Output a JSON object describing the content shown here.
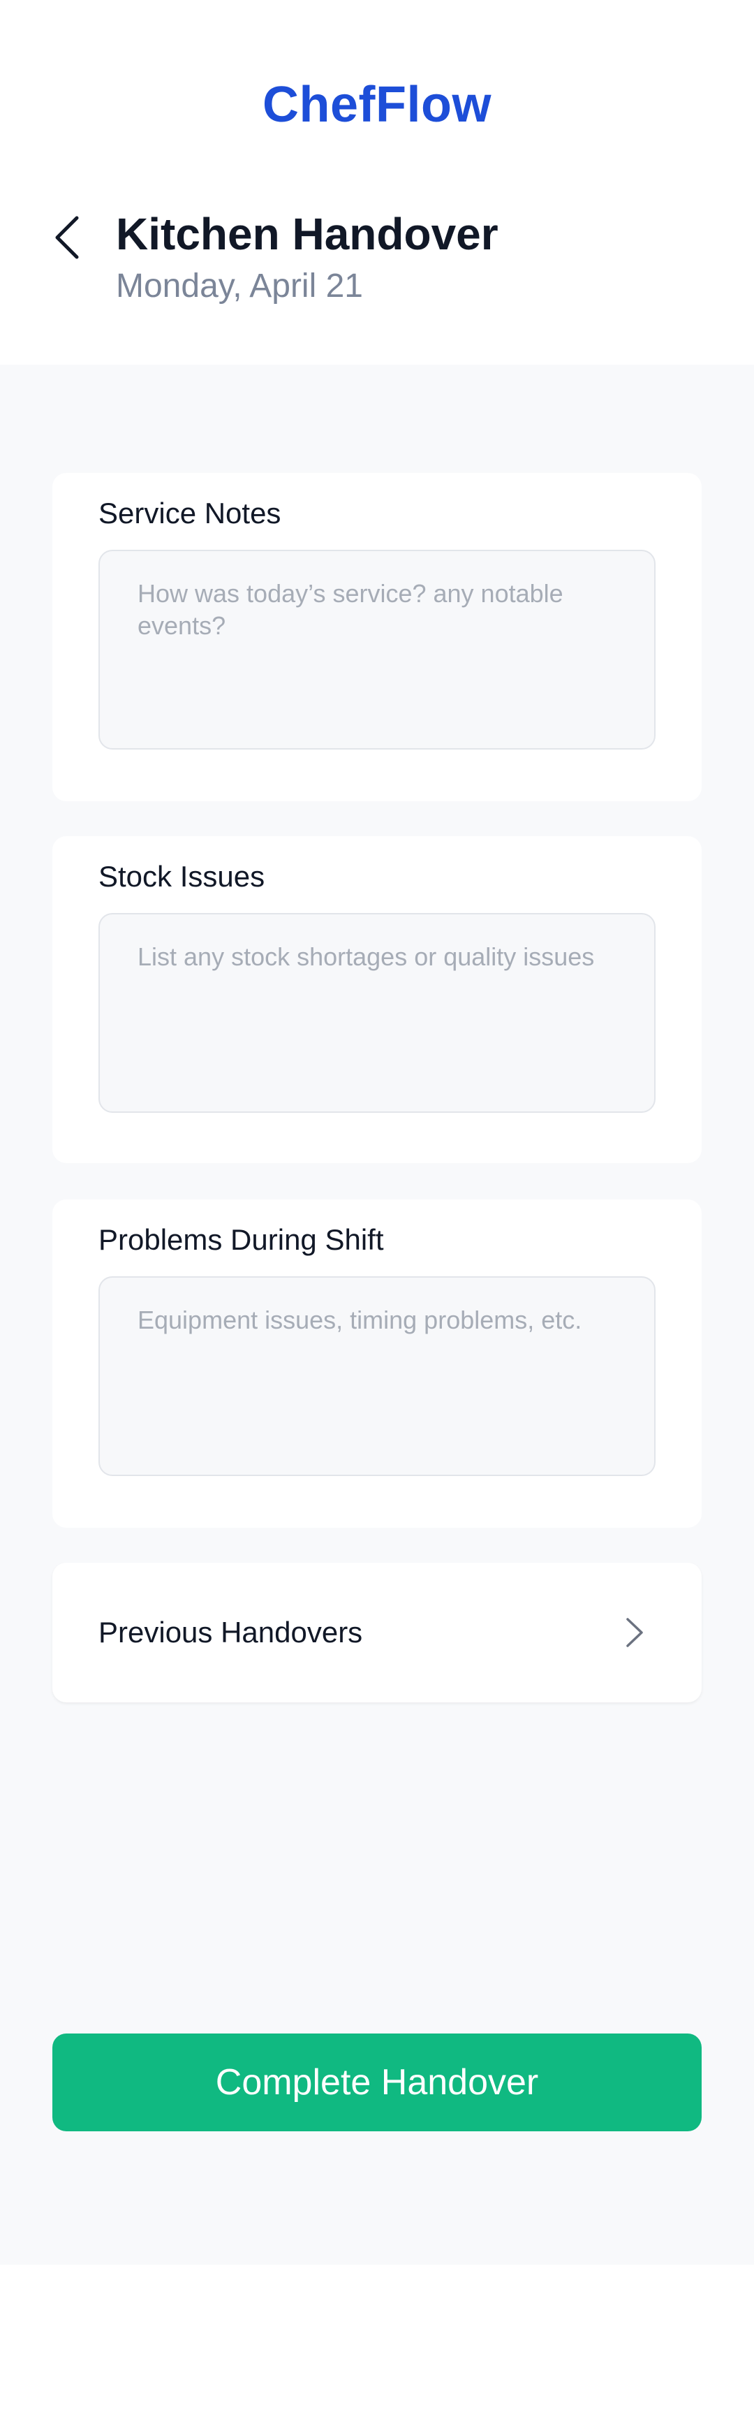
{
  "app": {
    "title": "ChefFlow",
    "brand_color": "#1d4ed8"
  },
  "header": {
    "back_icon": "chevron-left-icon",
    "title": "Kitchen Handover",
    "date": "Monday, April 21"
  },
  "form": {
    "service_notes": {
      "label": "Service Notes",
      "value": "",
      "placeholder": "How was today’s service? any notable events?"
    },
    "stock_issues": {
      "label": "Stock Issues",
      "value": "",
      "placeholder": "List any stock shortages or quality issues"
    },
    "problems": {
      "label": "Problems During Shift",
      "value": "",
      "placeholder": "Equipment issues, timing problems, etc."
    }
  },
  "previous_handovers": {
    "label": "Previous Handovers",
    "icon": "chevron-right-icon"
  },
  "actions": {
    "complete_label": "Complete Handover",
    "complete_color": "#10b981"
  }
}
